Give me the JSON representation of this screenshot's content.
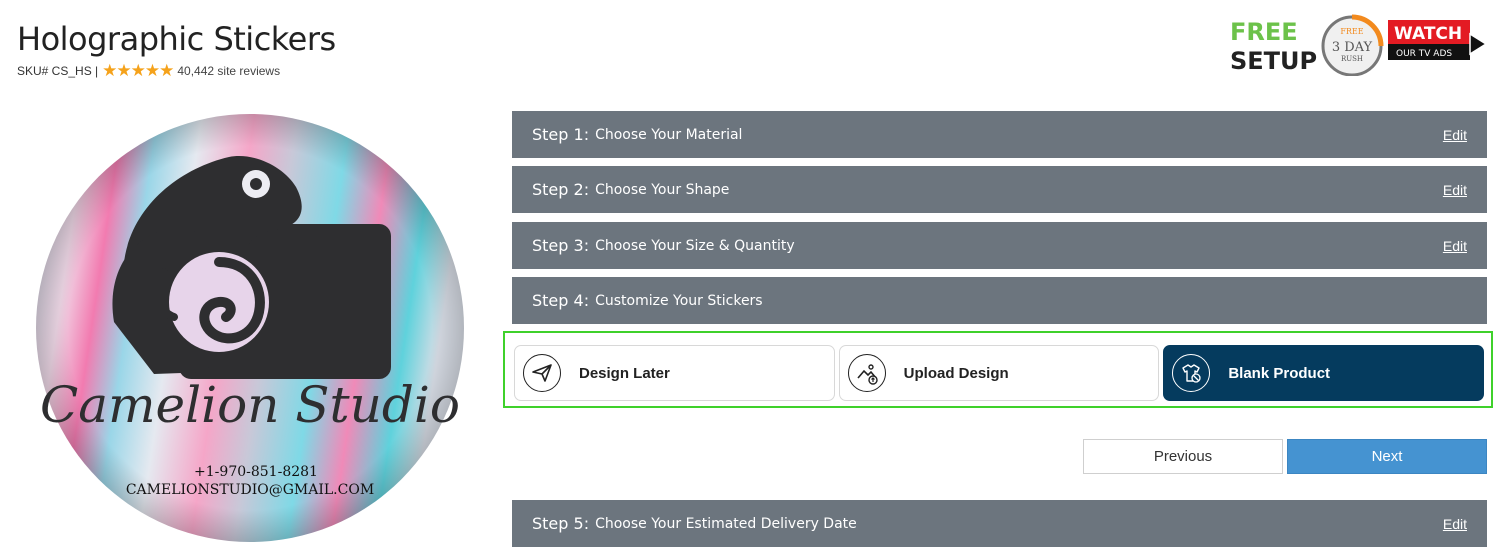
{
  "product": {
    "title": "Holographic Stickers",
    "sku": "SKU# CS_HS |",
    "stars": "★★★★★",
    "reviews": "40,442 site reviews",
    "image": {
      "icon": "camera-chameleon-logo",
      "brand_text": "Camelion Studio",
      "phone": "+1-970-851-8281",
      "email": "CAMELIONSTUDIO@GMAIL.COM"
    }
  },
  "badges": {
    "free": "FREE",
    "setup": "SETUP",
    "rush_top": "FREE",
    "rush_mid": "3 DAY",
    "rush_bottom": "RUSH",
    "watch": "WATCH",
    "tv_ads": "OUR TV ADS"
  },
  "steps": [
    {
      "num": "Step 1:",
      "label": "Choose Your Material",
      "edit": "Edit"
    },
    {
      "num": "Step 2:",
      "label": "Choose Your Shape",
      "edit": "Edit"
    },
    {
      "num": "Step 3:",
      "label": "Choose Your Size & Quantity",
      "edit": "Edit"
    },
    {
      "num": "Step 4:",
      "label": "Customize Your Stickers"
    },
    {
      "num": "Step 5:",
      "label": "Choose Your Estimated Delivery Date",
      "edit": "Edit"
    }
  ],
  "options": [
    {
      "label": "Design Later",
      "icon": "paper-plane-icon",
      "selected": false
    },
    {
      "label": "Upload Design",
      "icon": "image-upload-icon",
      "selected": false
    },
    {
      "label": "Blank Product",
      "icon": "blank-product-icon",
      "selected": true
    }
  ],
  "nav": {
    "previous": "Previous",
    "next": "Next"
  },
  "colors": {
    "step_bg": "#6c757e",
    "selected_bg": "#053b5e",
    "highlight": "#3fd12b",
    "next_bg": "#4593d1",
    "stars": "#f5a21b"
  }
}
